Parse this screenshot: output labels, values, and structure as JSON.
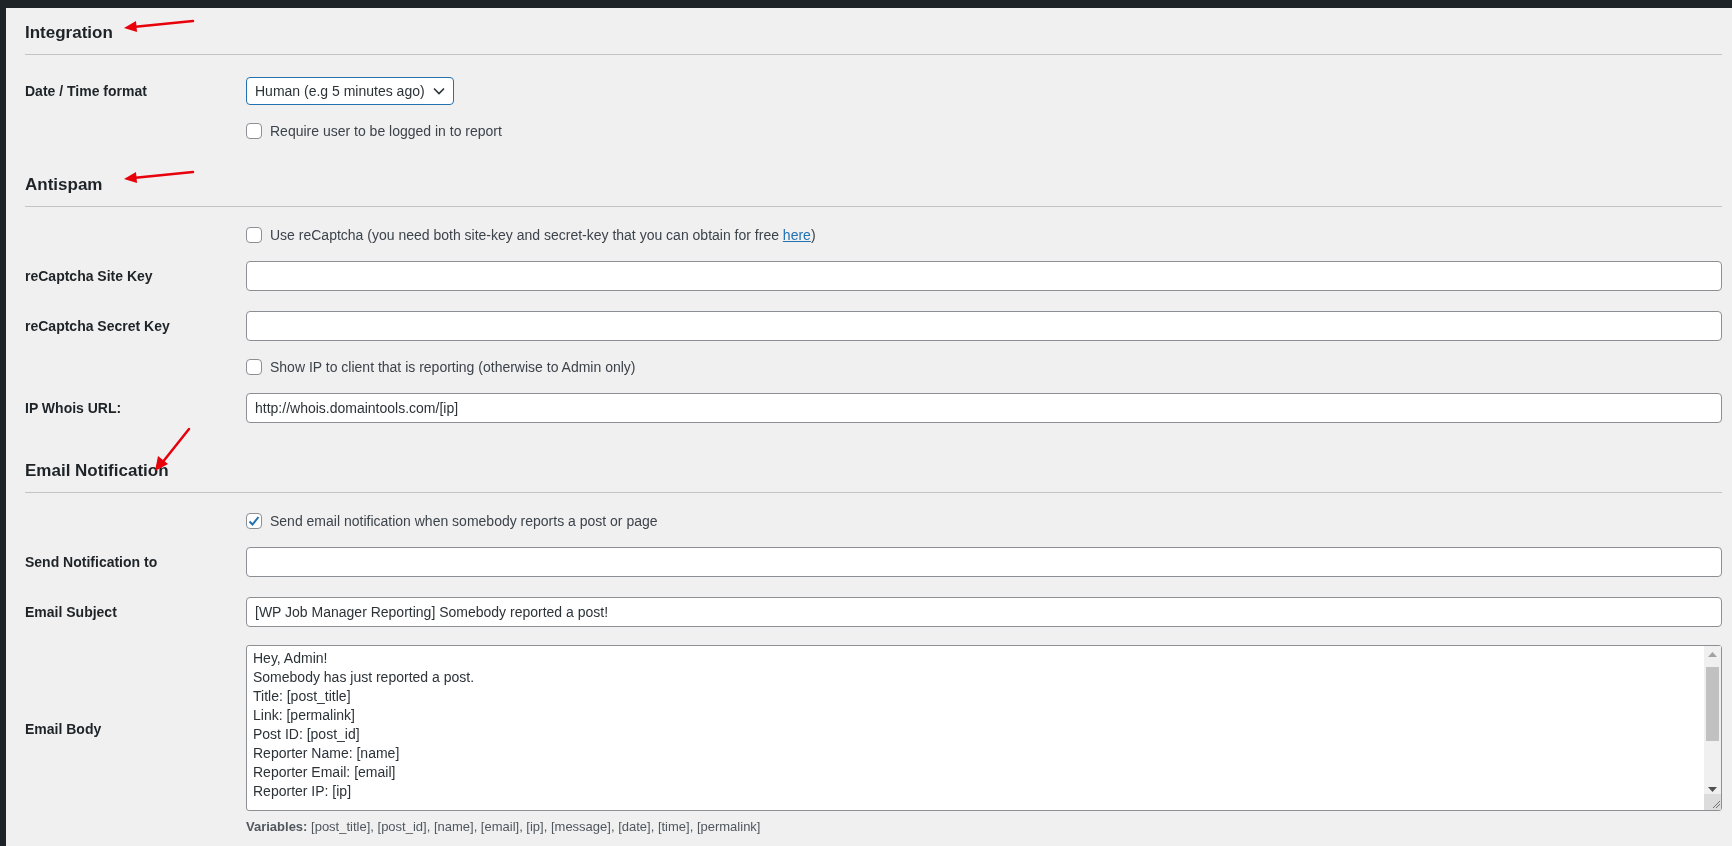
{
  "sections": [
    {
      "heading": "Integration",
      "annotation": {
        "kind": "left"
      },
      "rows": [
        {
          "kind": "select",
          "label": "Date / Time format",
          "value": "Human (e.g 5 minutes ago)"
        },
        {
          "kind": "checkbox",
          "text": "Require user to be logged in to report",
          "checked": false
        }
      ]
    },
    {
      "heading": "Antispam",
      "annotation": {
        "kind": "left"
      },
      "rows": [
        {
          "kind": "checkbox",
          "text": "Use reCaptcha (you need both site-key and secret-key that you can obtain for free ",
          "link": "here",
          "text_after": ")",
          "checked": false
        },
        {
          "kind": "text",
          "label": "reCaptcha Site Key"
        },
        {
          "kind": "text",
          "label": "reCaptcha Secret Key"
        },
        {
          "kind": "checkbox",
          "text": "Show IP to client that is reporting (otherwise to Admin only)",
          "checked": false
        },
        {
          "kind": "text",
          "label": "IP Whois URL:",
          "value": "http://whois.domaintools.com/[ip]"
        }
      ]
    },
    {
      "heading": "Email Notification",
      "annotation": {
        "kind": "down"
      },
      "rows": [
        {
          "kind": "checkbox",
          "text": "Send email notification when somebody reports a post or page",
          "checked": true
        },
        {
          "kind": "text",
          "label": "Send Notification to"
        },
        {
          "kind": "text",
          "label": "Email Subject",
          "value": "[WP Job Manager Reporting] Somebody reported a post!"
        },
        {
          "kind": "textarea",
          "label": "Email Body",
          "value": "Hey, Admin!\nSomebody has just reported a post.\nTitle: [post_title]\nLink: [permalink]\nPost ID: [post_id]\nReporter Name: [name]\nReporter Email: [email]\nReporter IP: [ip]",
          "note": "**Variables:** [post_title], [post_id], [name], [email], [ip], [message], [date], [time], [permalink]"
        }
      ]
    }
  ]
}
